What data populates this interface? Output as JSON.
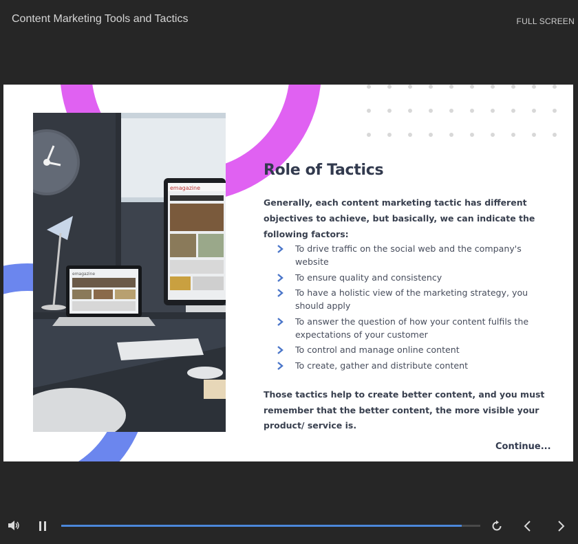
{
  "header": {
    "course_title": "Content Marketing Tools and Tactics",
    "fullscreen_label": "FULL SCREEN"
  },
  "slide": {
    "title": "Role of Tactics",
    "intro": "Generally, each content marketing tactic has different objectives to achieve, but basically, we can indicate the following factors:",
    "bullets": [
      "To drive traffic on the social web and the company's website",
      "To ensure quality and consistency",
      "To have a holistic view of the marketing strategy, you should apply",
      "To answer the question of how your content fulfils the expectations of your customer",
      "To control and manage online content",
      "To create, gather and distribute content"
    ],
    "outro": "Those tactics help to create better content, and you must remember that the better content, the more visible your product/ service is.",
    "continue_label": "Continue...",
    "photo_monitor_brand": "emagazine",
    "photo_laptop_brand": "emagazine"
  },
  "player": {
    "progress": 0.955,
    "icons": [
      "volume-icon",
      "pause-icon",
      "replay-icon",
      "previous-icon",
      "next-icon"
    ]
  },
  "colors": {
    "page_bg": "#262626",
    "accent_pink": "#e061f2",
    "accent_blue": "#6b86ee",
    "bullet_chevron": "#4b76c9",
    "progress_fill": "#4b87d9",
    "heading_text": "#323a4e"
  }
}
